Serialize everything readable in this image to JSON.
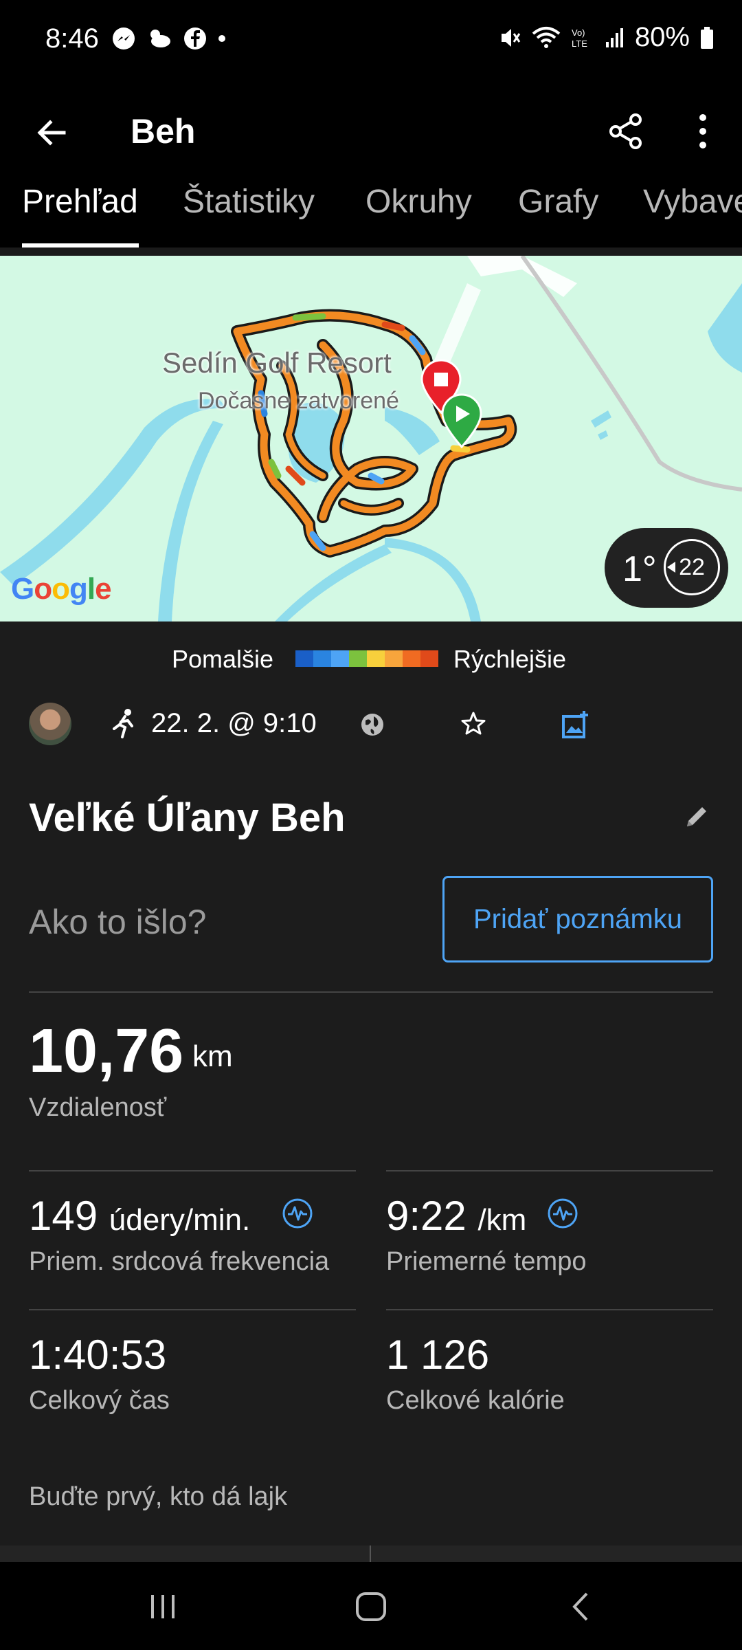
{
  "status_bar": {
    "time": "8:46",
    "battery": "80%",
    "left_icons": [
      "messenger-icon",
      "weather-icon",
      "facebook-icon",
      "dot-icon"
    ],
    "right_icons": [
      "mute-icon",
      "wifi-icon",
      "volte-icon",
      "signal-icon",
      "battery-icon"
    ]
  },
  "app_bar": {
    "title": "Beh"
  },
  "tabs": [
    {
      "label": "Prehľad",
      "active": true
    },
    {
      "label": "Štatistiky",
      "active": false
    },
    {
      "label": "Okruhy",
      "active": false
    },
    {
      "label": "Grafy",
      "active": false
    },
    {
      "label": "Vybave",
      "active": false
    }
  ],
  "map": {
    "place_name": "Sedín Golf Resort",
    "place_status": "Dočasne zatvorené",
    "temperature": "1°",
    "wind": "22",
    "google_letters": [
      "G",
      "o",
      "o",
      "g",
      "l",
      "e"
    ],
    "colors": {
      "background": "#d3f9e4",
      "water": "#8fdcec",
      "route_main": "#f28a22"
    }
  },
  "legend": {
    "slow": "Pomalšie",
    "fast": "Rýchlejšie",
    "colors": [
      "#1a5fc7",
      "#2a84e0",
      "#4ea4f5",
      "#7cc23e",
      "#f7d03c",
      "#f7a53c",
      "#f06b22",
      "#e04a1a"
    ]
  },
  "meta": {
    "date": "22. 2. @ 9:10"
  },
  "activity": {
    "title": "Veľké Úľany Beh",
    "prompt": "Ako to išlo?",
    "add_note_label": "Pridať poznámku"
  },
  "stats": {
    "distance_value": "10,76",
    "distance_unit": "km",
    "distance_label": "Vzdialenosť",
    "hr_value": "149",
    "hr_unit": "údery/min.",
    "hr_label": "Priem. srdcová frekvencia",
    "pace_value": "9:22",
    "pace_unit": "/km",
    "pace_label": "Priemerné tempo",
    "time_value": "1:40:53",
    "time_label": "Celkový čas",
    "calories_value": "1 126",
    "calories_label": "Celkové kalórie"
  },
  "social": {
    "like_prompt": "Buďte prvý, kto dá lajk"
  },
  "accent_color": "#4ea4f5"
}
